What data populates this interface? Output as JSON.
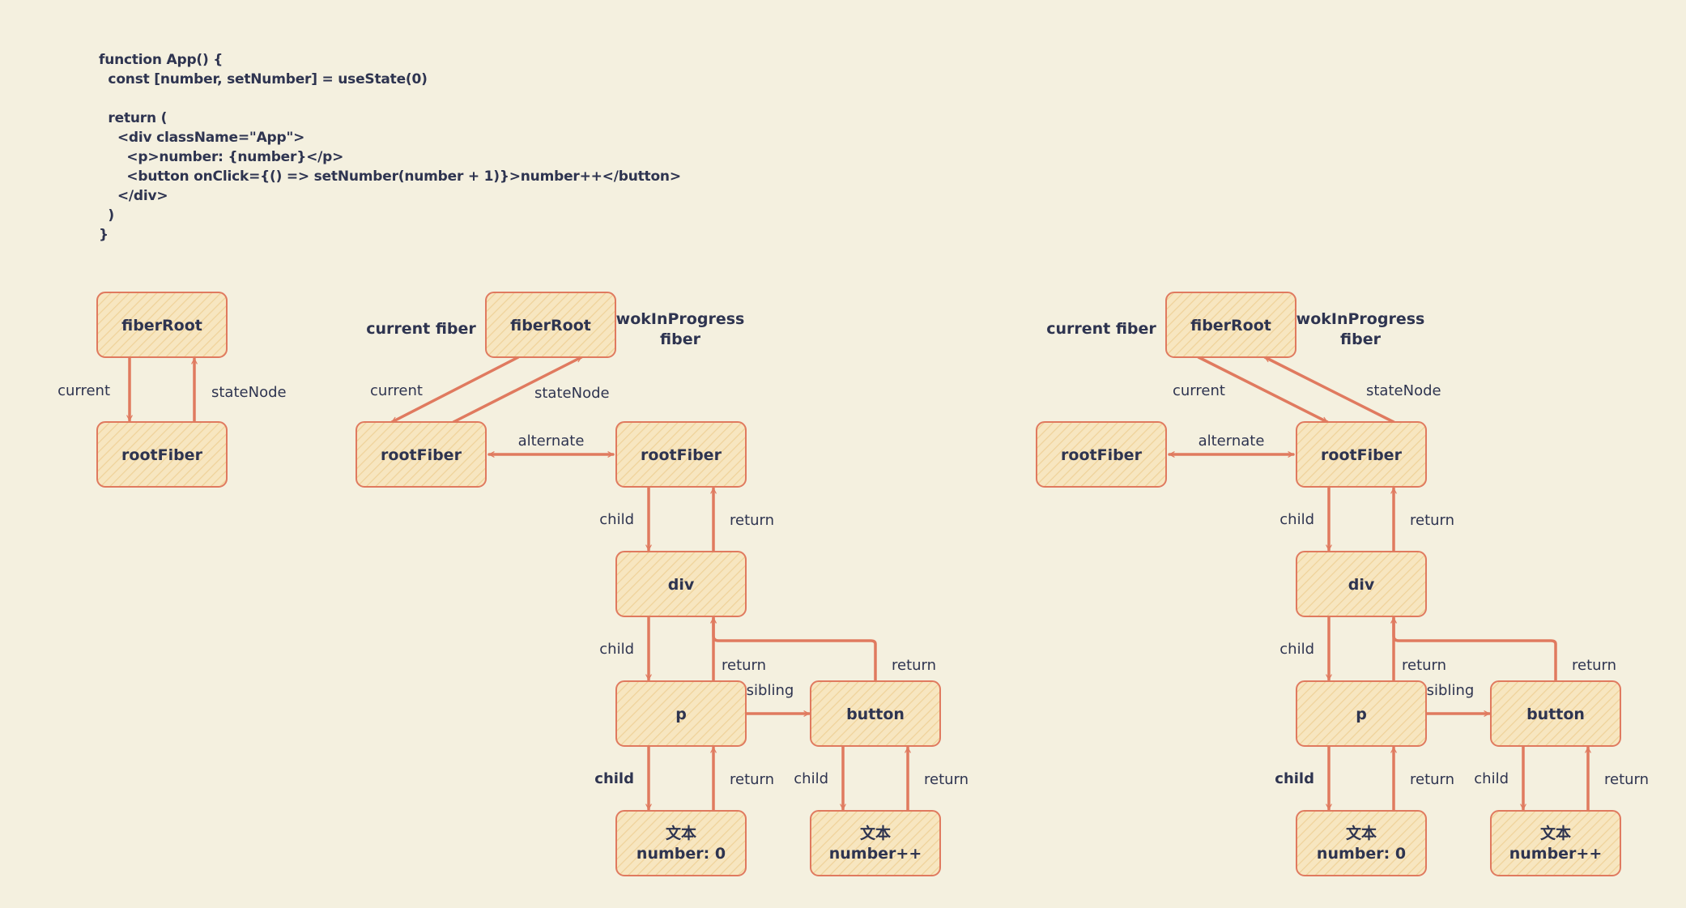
{
  "code": {
    "lines": [
      "function App() {",
      "  const [number, setNumber] = useState(0)",
      "",
      "  return (",
      "    <div className=\"App\">",
      "      <p>number: {number}</p>",
      "      <button onClick={() => setNumber(number + 1)}>number++</button>",
      "    </div>",
      "  )",
      "}"
    ]
  },
  "colors": {
    "background": "#f4f0df",
    "stroke": "#e07a5f",
    "fill": "#f7e6c0",
    "hatch": "#efd29a",
    "text": "#2e3450"
  },
  "diagrams": [
    {
      "id": "initial",
      "titles": [],
      "nodes": [
        {
          "id": "fiberRoot",
          "lines": [
            "fiberRoot"
          ]
        },
        {
          "id": "rootFiber",
          "lines": [
            "rootFiber"
          ]
        }
      ],
      "edges": [
        {
          "from": "fiberRoot",
          "to": "rootFiber",
          "label": "current"
        },
        {
          "from": "rootFiber",
          "to": "fiberRoot",
          "label": "stateNode"
        }
      ]
    },
    {
      "id": "mount-workInProgress",
      "titles": [
        "current fiber",
        "wokInProgress",
        "fiber"
      ],
      "nodes": [
        {
          "id": "fiberRoot",
          "lines": [
            "fiberRoot"
          ]
        },
        {
          "id": "rootFiberCurrent",
          "lines": [
            "rootFiber"
          ]
        },
        {
          "id": "rootFiberWip",
          "lines": [
            "rootFiber"
          ]
        },
        {
          "id": "div",
          "lines": [
            "div"
          ]
        },
        {
          "id": "p",
          "lines": [
            "p"
          ]
        },
        {
          "id": "button",
          "lines": [
            "button"
          ]
        },
        {
          "id": "textP",
          "lines": [
            "文本",
            "number: 0"
          ]
        },
        {
          "id": "textButton",
          "lines": [
            "文本",
            "number++"
          ]
        }
      ],
      "edges": [
        {
          "from": "fiberRoot",
          "to": "rootFiberCurrent",
          "label": "current"
        },
        {
          "from": "rootFiberCurrent",
          "to": "fiberRoot",
          "label": "stateNode"
        },
        {
          "from": "rootFiberCurrent",
          "to": "rootFiberWip",
          "label": "alternate",
          "bidirectional": true
        },
        {
          "from": "rootFiberWip",
          "to": "div",
          "label": "child"
        },
        {
          "from": "div",
          "to": "rootFiberWip",
          "label": "return"
        },
        {
          "from": "div",
          "to": "p",
          "label": "child"
        },
        {
          "from": "p",
          "to": "div",
          "label": "return"
        },
        {
          "from": "button",
          "to": "div",
          "label": "return"
        },
        {
          "from": "p",
          "to": "button",
          "label": "sibling"
        },
        {
          "from": "p",
          "to": "textP",
          "label": "child"
        },
        {
          "from": "textP",
          "to": "p",
          "label": "return"
        },
        {
          "from": "button",
          "to": "textButton",
          "label": "child"
        },
        {
          "from": "textButton",
          "to": "button",
          "label": "return"
        }
      ]
    },
    {
      "id": "commit-switch",
      "titles": [
        "current fiber",
        "wokInProgress",
        "fiber"
      ],
      "nodes": [
        {
          "id": "fiberRoot",
          "lines": [
            "fiberRoot"
          ]
        },
        {
          "id": "rootFiberOld",
          "lines": [
            "rootFiber"
          ]
        },
        {
          "id": "rootFiberCurrent",
          "lines": [
            "rootFiber"
          ]
        },
        {
          "id": "div",
          "lines": [
            "div"
          ]
        },
        {
          "id": "p",
          "lines": [
            "p"
          ]
        },
        {
          "id": "button",
          "lines": [
            "button"
          ]
        },
        {
          "id": "textP",
          "lines": [
            "文本",
            "number: 0"
          ]
        },
        {
          "id": "textButton",
          "lines": [
            "文本",
            "number++"
          ]
        }
      ],
      "edges": [
        {
          "from": "fiberRoot",
          "to": "rootFiberCurrent",
          "label": "current"
        },
        {
          "from": "rootFiberCurrent",
          "to": "fiberRoot",
          "label": "stateNode"
        },
        {
          "from": "rootFiberOld",
          "to": "rootFiberCurrent",
          "label": "alternate",
          "bidirectional": true
        },
        {
          "from": "rootFiberCurrent",
          "to": "div",
          "label": "child"
        },
        {
          "from": "div",
          "to": "rootFiberCurrent",
          "label": "return"
        },
        {
          "from": "div",
          "to": "p",
          "label": "child"
        },
        {
          "from": "p",
          "to": "div",
          "label": "return"
        },
        {
          "from": "button",
          "to": "div",
          "label": "return"
        },
        {
          "from": "p",
          "to": "button",
          "label": "sibling"
        },
        {
          "from": "p",
          "to": "textP",
          "label": "child"
        },
        {
          "from": "textP",
          "to": "p",
          "label": "return"
        },
        {
          "from": "button",
          "to": "textButton",
          "label": "child"
        },
        {
          "from": "textButton",
          "to": "button",
          "label": "return"
        }
      ]
    }
  ]
}
